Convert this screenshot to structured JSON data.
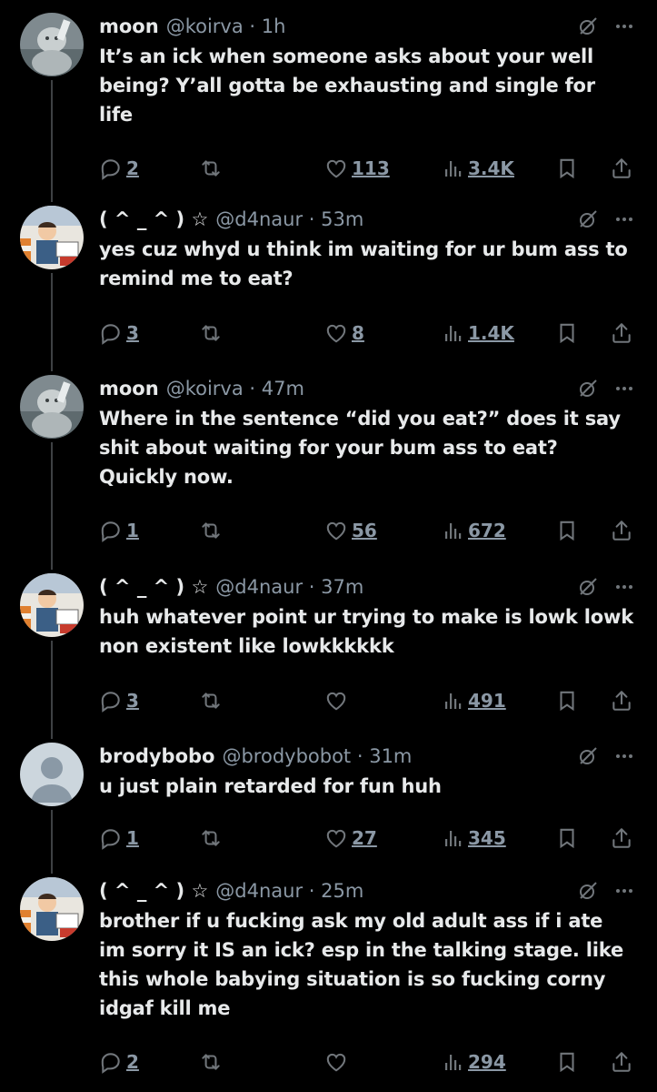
{
  "colors": {
    "background": "#000000",
    "text": "#e7e9ea",
    "muted": "#71767b",
    "thread_line": "#3e4144"
  },
  "tweets": [
    {
      "name": "moon",
      "handle": "@koirva",
      "time": "1h",
      "text": "It’s an ick when someone asks about your well being? Y’all gotta be exhausting and single for life",
      "replies": "2",
      "reposts": "",
      "likes": "113",
      "views": "3.4K",
      "avatar": "moon-avatar"
    },
    {
      "name": "( ^ _ ^ ) ☆",
      "handle": "@d4naur",
      "time": "53m",
      "text": "yes cuz whyd u think im waiting for ur bum ass to remind me to eat?",
      "replies": "3",
      "reposts": "",
      "likes": "8",
      "views": "1.4K",
      "avatar": "cartoon-avatar"
    },
    {
      "name": "moon",
      "handle": "@koirva",
      "time": "47m",
      "text": "Where in the sentence “did you eat?” does it say shit about waiting for your bum ass to eat? Quickly now.",
      "replies": "1",
      "reposts": "",
      "likes": "56",
      "views": "672",
      "avatar": "moon-avatar"
    },
    {
      "name": "( ^ _ ^ ) ☆",
      "handle": "@d4naur",
      "time": "37m",
      "text": "huh whatever point ur trying to make is lowk lowk non existent like lowkkkkkk",
      "replies": "3",
      "reposts": "",
      "likes": "",
      "views": "491",
      "avatar": "cartoon-avatar"
    },
    {
      "name": "brodybobo",
      "handle": "@brodybobot",
      "time": "31m",
      "text": "u just plain retarded for fun huh",
      "replies": "1",
      "reposts": "",
      "likes": "27",
      "views": "345",
      "avatar": "default-avatar"
    },
    {
      "name": "( ^ _ ^ ) ☆",
      "handle": "@d4naur",
      "time": "25m",
      "text": "brother if u fucking ask my old adult ass if i ate im sorry it IS an ick? esp in the talking stage. like this whole babying situation is so fucking corny idgaf kill me",
      "replies": "2",
      "reposts": "",
      "likes": "",
      "views": "294",
      "avatar": "cartoon-avatar"
    }
  ]
}
